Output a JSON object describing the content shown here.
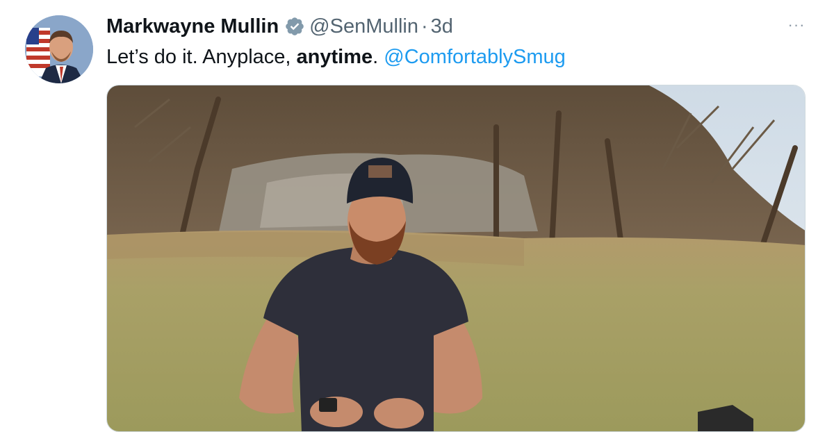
{
  "tweet": {
    "author_name": "Markwayne Mullin",
    "handle": "@SenMullin",
    "separator": "·",
    "time": "3d",
    "text_part1": "Let’s do it. Anyplace, ",
    "text_bold": "anytime",
    "text_part2": ". ",
    "mention": "@ComfortablySmug",
    "more_icon": "···"
  },
  "colors": {
    "link": "#1d9bf0",
    "verified_badge": "#829aab",
    "secondary_text": "#536471"
  },
  "icons": [
    "verified-badge-icon",
    "more-options-icon"
  ]
}
